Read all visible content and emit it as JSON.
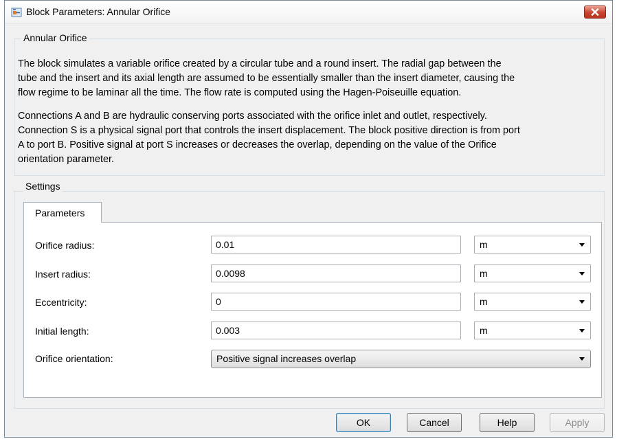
{
  "window": {
    "title": "Block Parameters: Annular Orifice"
  },
  "description": {
    "group_label": "Annular Orifice",
    "paragraph1_lines": [
      "The block simulates a variable orifice created by a circular tube and a round insert. The radial gap between the",
      "tube and the insert and its axial length are assumed to be essentially smaller than the insert diameter, causing the",
      "flow regime to be laminar all the time. The flow rate is computed using the Hagen-Poiseuille equation."
    ],
    "paragraph2_lines": [
      "Connections A and B are hydraulic conserving ports associated with the orifice inlet and outlet, respectively.",
      "Connection S is a physical signal port that controls the insert displacement. The block positive direction is from port",
      "A to port B. Positive signal at port S increases or decreases the overlap, depending on the value of the Orifice",
      "orientation parameter."
    ]
  },
  "settings": {
    "group_label": "Settings",
    "tab_label": "Parameters",
    "params": [
      {
        "label": "Orifice radius:",
        "value": "0.01",
        "unit": "m"
      },
      {
        "label": "Insert radius:",
        "value": "0.0098",
        "unit": "m"
      },
      {
        "label": "Eccentricity:",
        "value": "0",
        "unit": "m"
      },
      {
        "label": "Initial length:",
        "value": "0.003",
        "unit": "m"
      }
    ],
    "orientation": {
      "label": "Orifice orientation:",
      "selected": "Positive signal increases overlap"
    }
  },
  "buttons": {
    "ok": "OK",
    "cancel": "Cancel",
    "help": "Help",
    "apply": "Apply"
  },
  "colors": {
    "close_button": "#c7452f",
    "window_bg": "#f0f0f0",
    "default_button_border": "#3c7fb1"
  },
  "icons": {
    "title": "simulink-block-icon",
    "close": "close-icon",
    "dropdown": "chevron-down-icon"
  }
}
